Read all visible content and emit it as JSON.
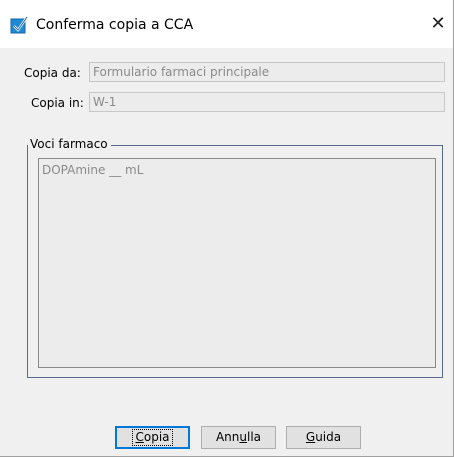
{
  "window": {
    "title": "Conferma copia a CCA",
    "close_glyph": "✕",
    "icon": "checkbox-checked-icon"
  },
  "form": {
    "copy_from_label": "Copia da:",
    "copy_from_value": "Formulario farmaci principale",
    "copy_to_label": "Copia in:",
    "copy_to_value": "W-1"
  },
  "drug_items": {
    "legend": "Voci farmaco",
    "items": [
      "DOPAmine __ mL"
    ]
  },
  "buttons": {
    "copy_pre": "",
    "copy_mnemonic": "C",
    "copy_post": "opia",
    "cancel_pre": "Ann",
    "cancel_mnemonic": "u",
    "cancel_post": "lla",
    "help_pre": "",
    "help_mnemonic": "G",
    "help_post": "uida"
  },
  "colors": {
    "accent": "#0078d7",
    "groupbox_border": "#5a6a8a"
  }
}
